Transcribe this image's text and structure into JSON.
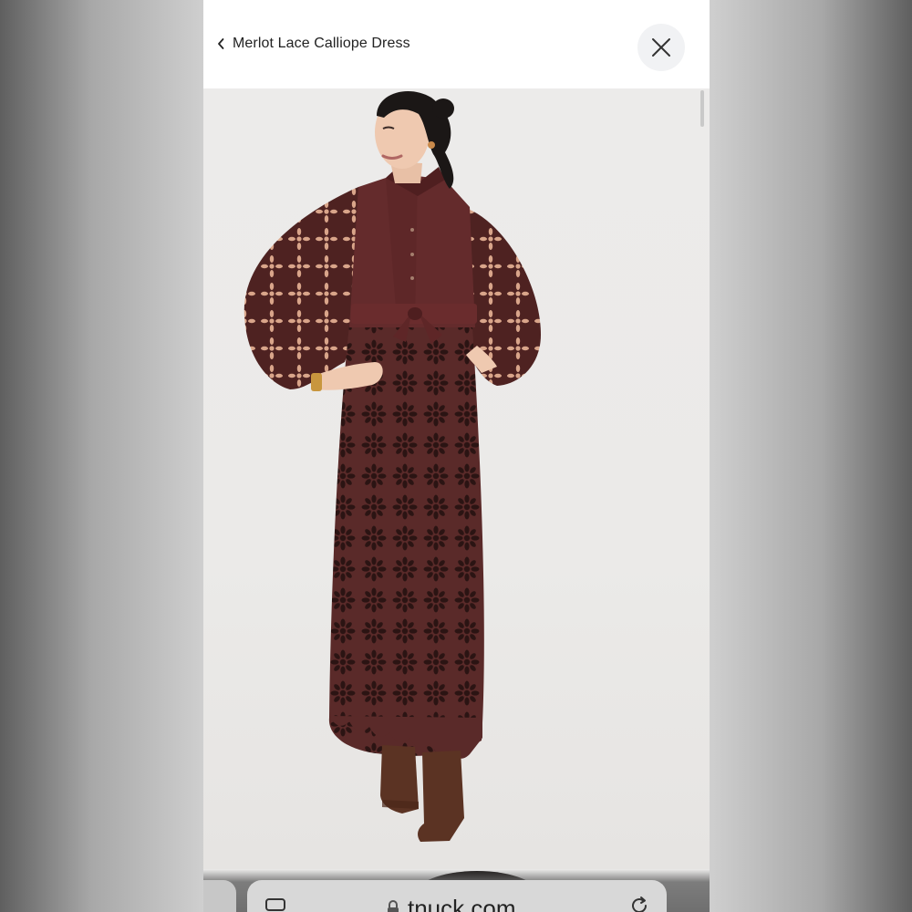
{
  "header": {
    "title": "Merlot Lace Calliope Dress",
    "back_icon": "chevron-left-icon",
    "close_icon": "close-icon"
  },
  "photo": {
    "subject": "product-photo",
    "dress_color": "#5a2a29",
    "boot_color": "#5b3323"
  },
  "browser": {
    "url": "tnuck.com",
    "lock_icon": "lock-icon",
    "reload_icon": "reload-icon",
    "tabs_icon": "tabs-icon"
  },
  "colors": {
    "header_bg": "#ffffff",
    "close_bg": "#f1f2f4",
    "title": "#222222"
  }
}
